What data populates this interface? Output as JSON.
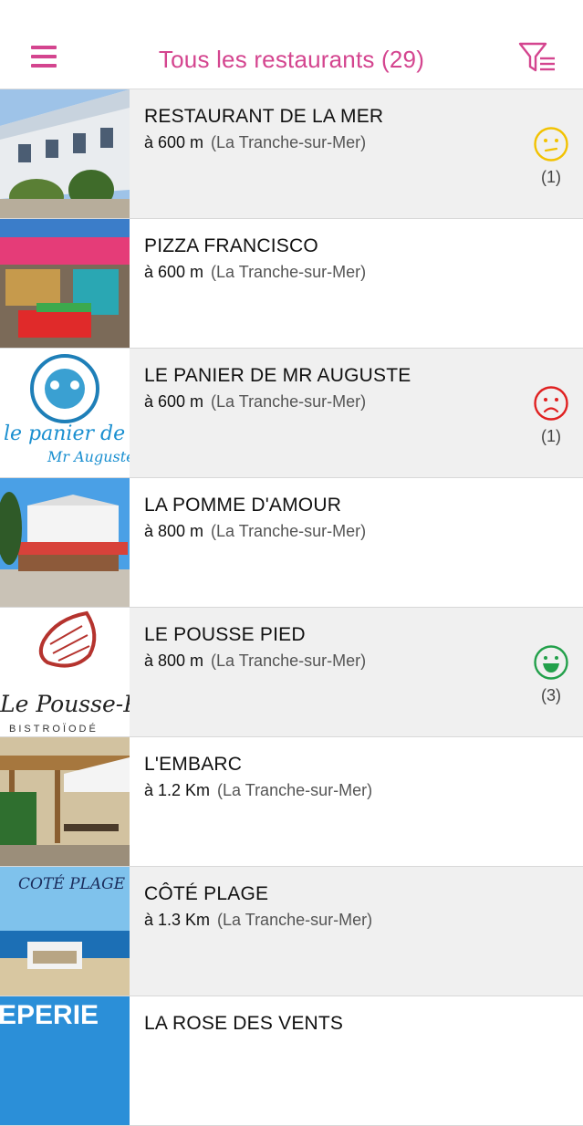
{
  "header": {
    "title": "Tous les restaurants (29)",
    "accent": "#d4458f"
  },
  "restaurants": [
    {
      "name": "RESTAURANT DE LA MER",
      "distance": "à 600 m",
      "town": "(La Tranche-sur-Mer)",
      "rating": "neutral",
      "count": "(1)"
    },
    {
      "name": "PIZZA FRANCISCO",
      "distance": "à 600 m",
      "town": "(La Tranche-sur-Mer)"
    },
    {
      "name": "LE PANIER DE MR AUGUSTE",
      "distance": "à 600 m",
      "town": "(La Tranche-sur-Mer)",
      "rating": "sad",
      "count": "(1)",
      "logo_text": "le panier de Mr Auguste"
    },
    {
      "name": "LA POMME D'AMOUR",
      "distance": "à 800 m",
      "town": "(La Tranche-sur-Mer)"
    },
    {
      "name": "LE POUSSE PIED",
      "distance": "à 800 m",
      "town": "(La Tranche-sur-Mer)",
      "rating": "happy",
      "count": "(3)",
      "logo_text": "Le Pousse-Pied",
      "logo_sub": "BISTROÏODÉ"
    },
    {
      "name": "L'EMBARC",
      "distance": "à 1.2 Km",
      "town": "(La Tranche-sur-Mer)"
    },
    {
      "name": "CÔTÉ PLAGE",
      "distance": "à 1.3 Km",
      "town": "(La Tranche-sur-Mer)",
      "logo_text": "COTÉ PLAGE"
    },
    {
      "name": "LA ROSE DES VENTS",
      "distance": "",
      "town": "",
      "logo_text": "EPERIE"
    }
  ],
  "rating_colors": {
    "neutral": "#f2c200",
    "sad": "#e02020",
    "happy": "#22a04a"
  }
}
